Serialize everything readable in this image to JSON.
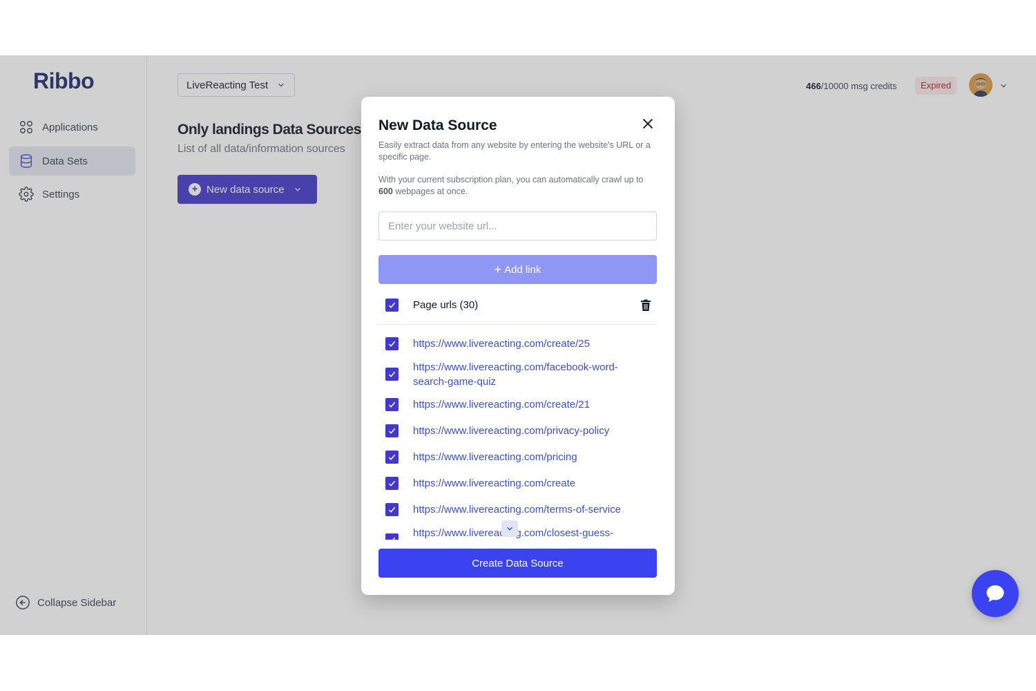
{
  "sidebar": {
    "logo": "Ribbo",
    "items": [
      {
        "label": "Applications",
        "icon": "grid-icon"
      },
      {
        "label": "Data Sets",
        "icon": "database-icon",
        "active": true
      },
      {
        "label": "Settings",
        "icon": "gear-icon"
      }
    ],
    "collapse_label": "Collapse Sidebar"
  },
  "header": {
    "workspace": "LiveReacting Test",
    "credits_used": "466",
    "credits_total": "/10000 msg credits",
    "status_badge": "Expired"
  },
  "main": {
    "title": "Only landings Data Sources",
    "subtitle": "List of all data/information sources",
    "new_source_label": "New data source"
  },
  "modal": {
    "title": "New Data Source",
    "description": "Easily extract data from any website by entering the website's URL or a specific page.",
    "plan_prefix": "With your current subscription plan, you can automatically crawl up to ",
    "plan_limit": "600",
    "plan_suffix": " webpages at once.",
    "url_placeholder": "Enter your website url...",
    "add_link_label": "Add link",
    "page_urls_label": "Page urls (30)",
    "urls": [
      "https://www.livereacting.com/create/25",
      "https://www.livereacting.com/facebook-word-search-game-quiz",
      "https://www.livereacting.com/create/21",
      "https://www.livereacting.com/privacy-policy",
      "https://www.livereacting.com/pricing",
      "https://www.livereacting.com/create",
      "https://www.livereacting.com/terms-of-service",
      "https://www.livereacting.com/closest-guess-"
    ],
    "create_label": "Create Data Source"
  },
  "colors": {
    "primary": "#4338ca",
    "button_blue": "#3b42f0",
    "add_link_disabled": "#9096f4",
    "link_text": "#3b4fd6",
    "expired_bg": "#fde8e8",
    "expired_text": "#b91c1c",
    "logo": "#1a2a6e"
  }
}
